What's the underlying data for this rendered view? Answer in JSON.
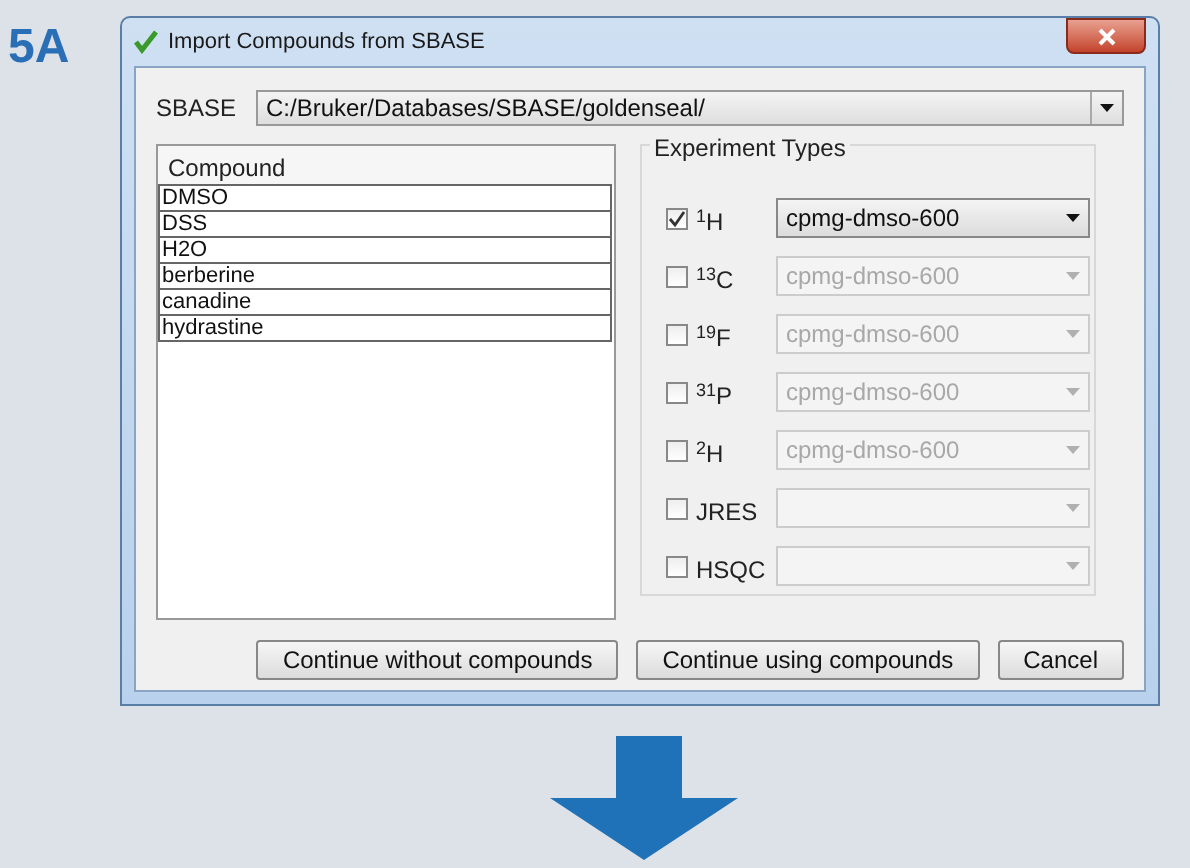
{
  "figure_label": "5A",
  "window": {
    "title": "Import Compounds from SBASE"
  },
  "sbase": {
    "label": "SBASE",
    "value": "C:/Bruker/Databases/SBASE/goldenseal/"
  },
  "compounds": {
    "header": "Compound",
    "rows": [
      "DMSO",
      "DSS",
      "H2O",
      "berberine",
      "canadine",
      "hydrastine"
    ]
  },
  "experiment_types": {
    "title": "Experiment Types",
    "items": [
      {
        "label": "$^{1}$H",
        "checked": true,
        "dropdown": {
          "value": "cpmg-dmso-600",
          "disabled": false
        }
      },
      {
        "label": "$^{13}$C",
        "checked": false,
        "dropdown": {
          "value": "cpmg-dmso-600",
          "disabled": true
        }
      },
      {
        "label": "$^{19}$F",
        "checked": false,
        "dropdown": {
          "value": "cpmg-dmso-600",
          "disabled": true
        }
      },
      {
        "label": "$^{31}$P",
        "checked": false,
        "dropdown": {
          "value": "cpmg-dmso-600",
          "disabled": true
        }
      },
      {
        "label": "$^{2}$H",
        "checked": false,
        "dropdown": {
          "value": "cpmg-dmso-600",
          "disabled": true
        }
      },
      {
        "label": "JRES",
        "checked": false,
        "dropdown": {
          "disabled": true
        }
      },
      {
        "label": "HSQC",
        "checked": false,
        "dropdown": {
          "disabled": true
        }
      }
    ]
  },
  "buttons": [
    "Continue without compounds",
    "Continue using compounds",
    "Cancel"
  ]
}
